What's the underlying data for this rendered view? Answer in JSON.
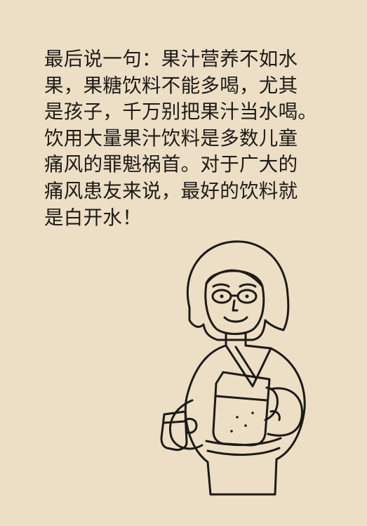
{
  "paragraph": {
    "lines": [
      "最后说一句：果汁营养不如水",
      "果，果糖饮料不能多喝，尤其",
      "是孩子，千万别把果汁当水喝。",
      "饮用大量果汁饮料是多数儿童",
      "痛风的罪魁祸首。对于广大的",
      "痛风患友来说，最好的饮料就",
      "是白开水！"
    ]
  },
  "illustration": {
    "icon": "woman-pouring-juice-icon",
    "background_color": "#ecdfc6",
    "line_color": "#1e1a16"
  }
}
